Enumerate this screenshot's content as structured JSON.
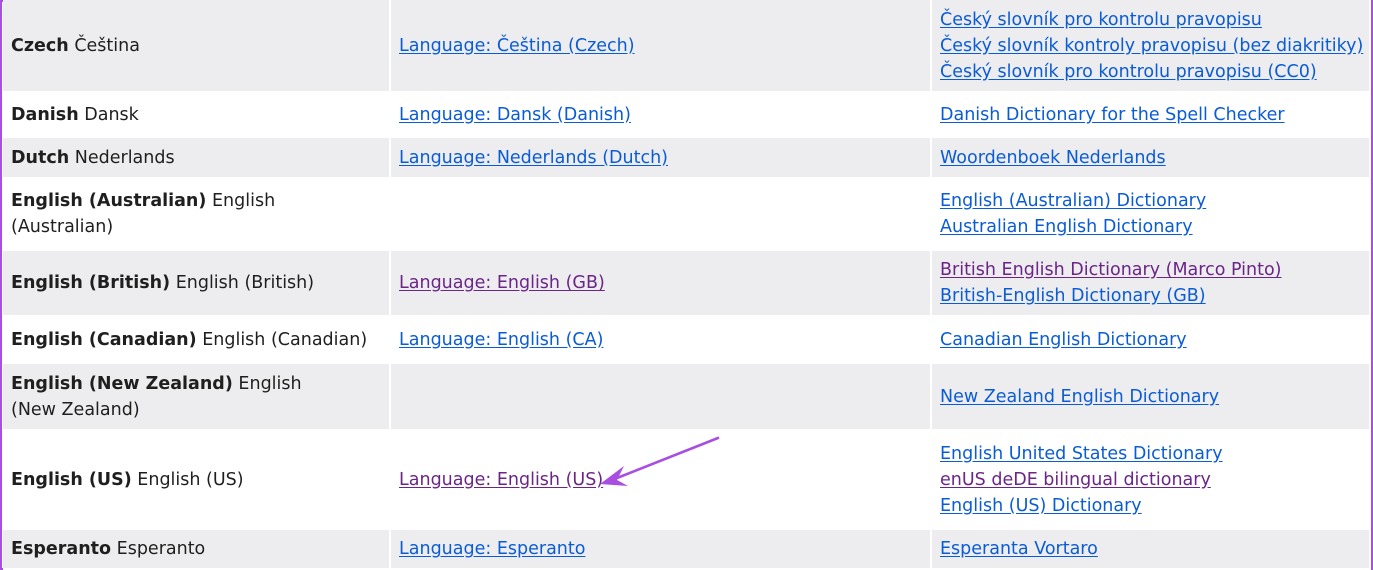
{
  "rows": [
    {
      "lang_bold": "Czech",
      "lang_native": "Čeština",
      "lang_link": {
        "text": "Language: Čeština (Czech)",
        "visited": false
      },
      "dicts": [
        {
          "text": "Český slovník pro kontrolu pravopisu",
          "visited": false
        },
        {
          "text": "Český slovník kontroly pravopisu (bez diakritiky)",
          "visited": false
        },
        {
          "text": "Český slovník pro kontrolu pravopisu (CC0)",
          "visited": false
        }
      ]
    },
    {
      "lang_bold": "Danish",
      "lang_native": "Dansk",
      "lang_link": {
        "text": "Language: Dansk (Danish)",
        "visited": false
      },
      "dicts": [
        {
          "text": "Danish Dictionary for the Spell Checker",
          "visited": false
        }
      ]
    },
    {
      "lang_bold": "Dutch",
      "lang_native": "Nederlands",
      "lang_link": {
        "text": "Language: Nederlands (Dutch)",
        "visited": false
      },
      "dicts": [
        {
          "text": "Woordenboek Nederlands",
          "visited": false
        }
      ]
    },
    {
      "lang_bold": "English (Australian)",
      "lang_native": "English (Australian)",
      "lang_link": null,
      "dicts": [
        {
          "text": "English (Australian) Dictionary",
          "visited": false
        },
        {
          "text": "Australian English Dictionary",
          "visited": false
        }
      ]
    },
    {
      "lang_bold": "English (British)",
      "lang_native": "English (British)",
      "lang_link": {
        "text": "Language: English (GB)",
        "visited": true
      },
      "dicts": [
        {
          "text": "British English Dictionary (Marco Pinto)",
          "visited": true
        },
        {
          "text": "British-English Dictionary (GB)",
          "visited": false
        }
      ]
    },
    {
      "lang_bold": "English (Canadian)",
      "lang_native": "English (Canadian)",
      "lang_link": {
        "text": "Language: English (CA)",
        "visited": false
      },
      "dicts": [
        {
          "text": "Canadian English Dictionary",
          "visited": false
        }
      ]
    },
    {
      "lang_bold": "English (New Zealand)",
      "lang_native": "English (New Zealand)",
      "lang_link": null,
      "dicts": [
        {
          "text": "New Zealand English Dictionary",
          "visited": false
        }
      ]
    },
    {
      "lang_bold": "English (US)",
      "lang_native": "English (US)",
      "lang_link": {
        "text": "Language: English (US)",
        "visited": true
      },
      "dicts": [
        {
          "text": "English United States Dictionary",
          "visited": false
        },
        {
          "text": "enUS deDE bilingual dictionary",
          "visited": true
        },
        {
          "text": "English (US) Dictionary",
          "visited": false
        }
      ]
    },
    {
      "lang_bold": "Esperanto",
      "lang_native": "Esperanto",
      "lang_link": {
        "text": "Language: Esperanto",
        "visited": false
      },
      "dicts": [
        {
          "text": "Esperanta Vortaro",
          "visited": false
        }
      ]
    }
  ],
  "colors": {
    "link": "#0a5cd6",
    "visited": "#6b2587",
    "stripe": "#ededef",
    "annotation": "#a84ee0"
  },
  "annotation": {
    "icon": "arrow-icon",
    "points_to": "Language: English (US)"
  }
}
